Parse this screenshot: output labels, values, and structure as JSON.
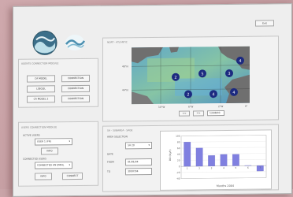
{
  "window": {
    "exit_label": "Exit"
  },
  "agents_module": {
    "title": "AGENTS CONNECTION MODULE",
    "rows": [
      {
        "left": "CA MODEL",
        "right": "CONNECTION"
      },
      {
        "left": "LSEGOL",
        "right": "CONNECTION"
      },
      {
        "left": "CA MODEL 2",
        "right": "CONNECTION"
      }
    ]
  },
  "users_module": {
    "title": "USERS CONNECTION MODULE",
    "active_users_label": "ACTIVE USERS",
    "active_users_value": "USER 1 (FR)",
    "info_button": "INFO",
    "connected_users_label": "CONNECTED USERS",
    "connected_users_value": "CONNECTED AN EMAIL",
    "info2_button": "INFO",
    "connect_button": "CONNECT"
  },
  "map_panel": {
    "title": "NORT - ATLANTIC",
    "lat_labels": [
      "48°N",
      "44°N"
    ],
    "lon_labels": [
      "10°W",
      "6°W",
      "2°W",
      "0°"
    ],
    "markers": [
      "4",
      "2",
      "5",
      "3",
      "2",
      "4",
      "4"
    ],
    "nav_prev": "<<",
    "nav_next": ">>",
    "date_value": "13/08/03"
  },
  "bottom_panel": {
    "tabs_label": "SA - SUBAREA - SAGE",
    "area_selection_label": "AREA SELECTION",
    "area_combo": "SA 20",
    "date_label": "DATE",
    "from_label": "FROM",
    "from_value": "01/01/04",
    "to_label": "TO",
    "to_value": "30/07/04"
  },
  "chart_data": {
    "type": "bar",
    "categories": [
      "1",
      "2",
      "3",
      "4",
      "5",
      "6",
      "7"
    ],
    "values": [
      80,
      60,
      35,
      38,
      38,
      1,
      -18
    ],
    "ylim": [
      -40,
      100
    ],
    "yticks": [
      "100",
      "80",
      "60",
      "40",
      "20",
      "0",
      "-20",
      "-40"
    ],
    "xlabel": "Months 2004",
    "ylabel": "DD (Kg/h)",
    "bar_color": "#8080e0"
  }
}
